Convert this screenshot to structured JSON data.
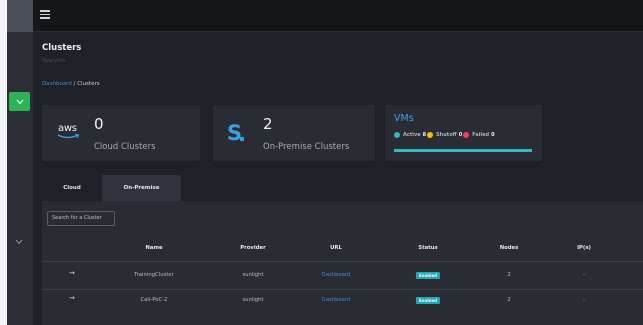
{
  "header": {
    "menu_icon": "hamburger-icon"
  },
  "sidebar": {
    "active_icon": "chevron-down-icon",
    "secondary_icon": "chevron-down-icon",
    "colors": {
      "active": "#2bb457"
    }
  },
  "page": {
    "title": "Clusters",
    "subtitle": "Overview",
    "breadcrumb": {
      "dashboard": "Dashboard",
      "separator": "/",
      "current": "Clusters"
    }
  },
  "cards": {
    "cloud": {
      "icon": "aws-logo",
      "logo_text": "aws",
      "count": "0",
      "label": "Cloud Clusters"
    },
    "onprem": {
      "icon": "s-logo",
      "logo_text": "S",
      "count": "2",
      "label": "On-Premise Clusters"
    },
    "vms": {
      "title": "VMs",
      "active": {
        "label": "Active",
        "value": "8",
        "color": "#2fb8c8"
      },
      "shutoff": {
        "label": "Shutoff",
        "value": "0",
        "color": "#f5b914"
      },
      "failed": {
        "label": "Failed",
        "value": "0",
        "color": "#ef3d5a"
      },
      "bar_fill_percent": 100
    }
  },
  "tabs": [
    {
      "label": "Cloud",
      "selected": false
    },
    {
      "label": "On-Premise",
      "selected": true
    }
  ],
  "search": {
    "placeholder": "Search for a Cluster"
  },
  "table": {
    "columns": [
      "Name",
      "Provider",
      "URL",
      "Status",
      "Nodes",
      "IP(s)"
    ],
    "rows": [
      {
        "arrow": "→",
        "name": "TrainingCluster",
        "provider": "sunlight",
        "url": "Dashboard",
        "status": "Enabled",
        "nodes": "2",
        "ips": "-"
      },
      {
        "arrow": "→",
        "name": "Cali-PoC-2",
        "provider": "sunlight",
        "url": "Dashboard",
        "status": "Enabled",
        "nodes": "2",
        "ips": "-"
      }
    ]
  }
}
